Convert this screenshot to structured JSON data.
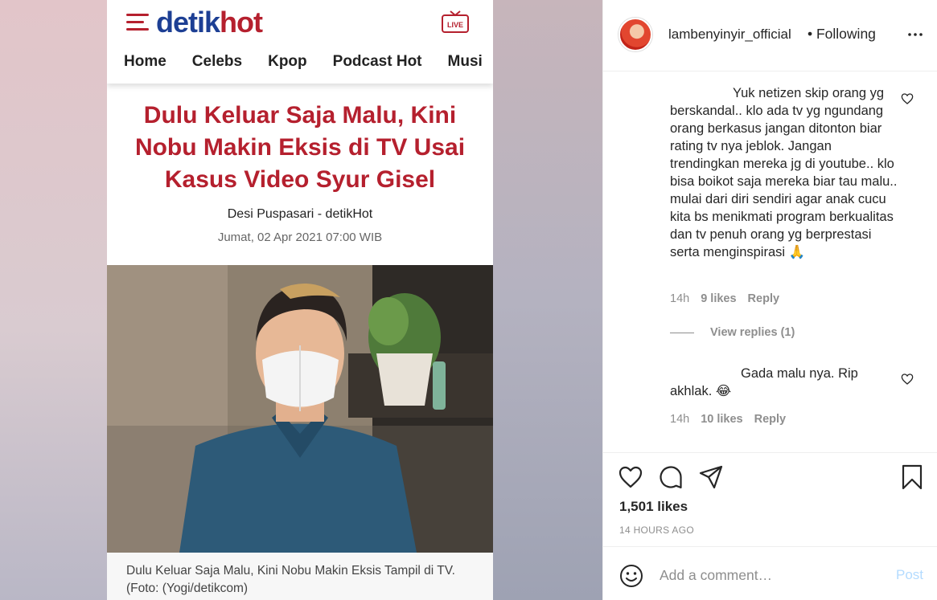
{
  "article": {
    "logo_part1": "detik",
    "logo_part2": "hot",
    "live_label": "LIVE",
    "nav": [
      "Home",
      "Celebs",
      "Kpop",
      "Podcast Hot",
      "Musi"
    ],
    "title": "Dulu Keluar Saja Malu, Kini Nobu Makin Eksis di TV Usai Kasus Video Syur Gisel",
    "author": "Desi Puspasari - detikHot",
    "date": "Jumat, 02 Apr 2021 07:00 WIB",
    "caption": "Dulu Keluar Saja Malu, Kini Nobu Makin Eksis Tampil di TV. (Foto: (Yogi/detikcom)",
    "brand_red": "#b5202e",
    "brand_blue": "#1d3f94"
  },
  "post": {
    "username": "lambenyinyir_official",
    "follow_status": "• Following",
    "comments": [
      {
        "text": "Yuk netizen skip orang yg berskandal.. klo ada tv yg ngundang orang berkasus jangan ditonton biar rating tv nya jeblok. Jangan trendingkan mereka jg di youtube.. klo bisa boikot saja mereka biar tau malu.. mulai dari diri sendiri agar anak cucu kita bs menikmati program berkualitas dan tv penuh orang yg berprestasi serta menginspirasi 🙏",
        "time": "14h",
        "likes": "9 likes",
        "reply": "Reply",
        "view_replies": "View replies (1)"
      },
      {
        "text": "Gada malu nya. Rip akhlak. 😂",
        "time": "14h",
        "likes": "10 likes",
        "reply": "Reply"
      }
    ],
    "likes_count": "1,501 likes",
    "posted_ago": "14 HOURS AGO",
    "comment_placeholder": "Add a comment…",
    "post_label": "Post"
  }
}
